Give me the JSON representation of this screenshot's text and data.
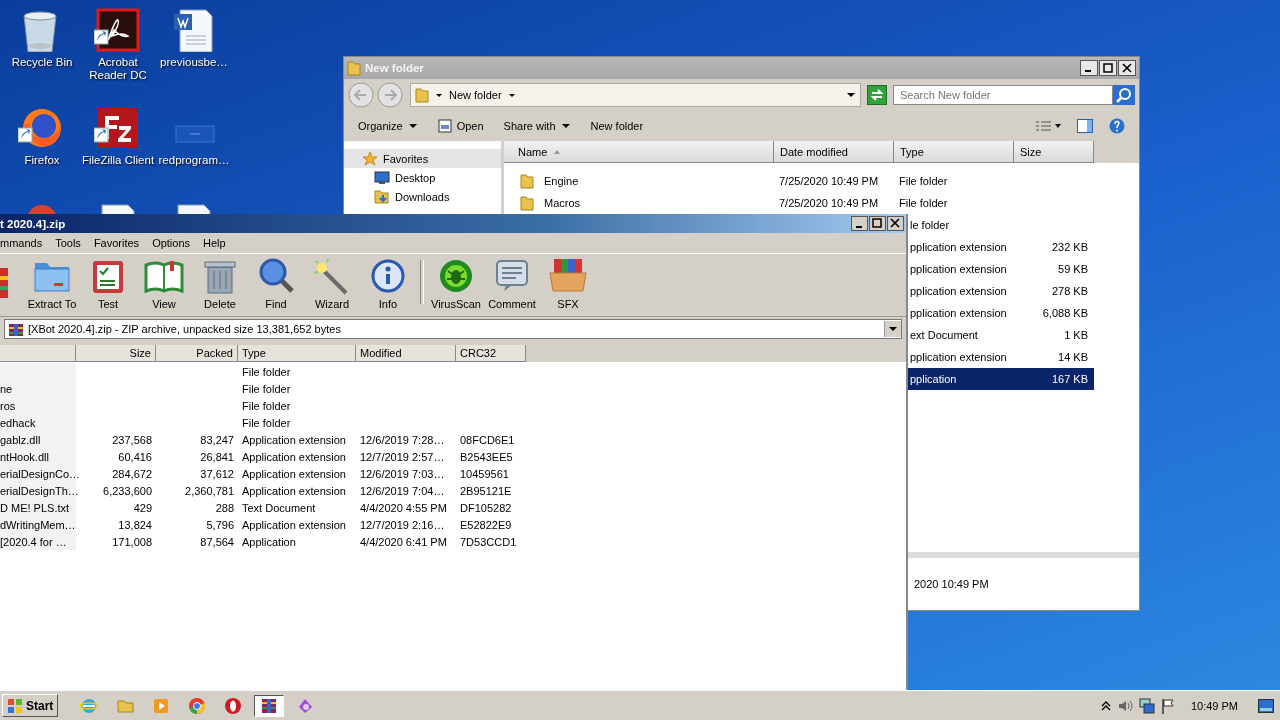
{
  "desktop_icons": [
    {
      "label": "Recycle Bin",
      "kind": "recycle"
    },
    {
      "label": "Acrobat Reader DC",
      "kind": "acrobat"
    },
    {
      "label": "previousbe…",
      "kind": "document"
    },
    {
      "label": "Firefox",
      "kind": "firefox"
    },
    {
      "label": "FileZilla Client",
      "kind": "filezilla"
    },
    {
      "label": "redprogram…",
      "kind": "blank"
    },
    {
      "kind": "redcircle"
    },
    {
      "kind": "page"
    },
    {
      "kind": "page"
    }
  ],
  "explorer": {
    "title": "New folder",
    "address": "New folder",
    "search": {
      "placeholder": "Search New folder"
    },
    "toolbar": [
      {
        "label": "Organize",
        "kind": "menu"
      },
      {
        "label": "Open",
        "kind": "open"
      },
      {
        "label": "Share with",
        "kind": "menu"
      },
      {
        "label": "New folder",
        "kind": "plain"
      }
    ],
    "nav": [
      {
        "label": "Favorites",
        "kind": "favorites",
        "selected": true
      },
      {
        "label": "Desktop",
        "kind": "desktop",
        "selected": false
      },
      {
        "label": "Downloads",
        "kind": "downloads",
        "selected": false
      }
    ],
    "columns": [
      "Name",
      "Date modified",
      "Type",
      "Size"
    ],
    "rows": [
      {
        "name": "Engine",
        "date": "7/25/2020 10:49 PM",
        "type": "File folder",
        "selected": false
      },
      {
        "name": "Macros",
        "date": "7/25/2020 10:49 PM",
        "type": "File folder",
        "selected": false
      },
      {
        "type": "le folder",
        "selected": false
      },
      {
        "type": "pplication extension",
        "size": "232 KB",
        "selected": false
      },
      {
        "type": "pplication extension",
        "size": "59 KB",
        "selected": false
      },
      {
        "type": "pplication extension",
        "size": "278 KB",
        "selected": false
      },
      {
        "type": "pplication extension",
        "size": "6,088 KB",
        "selected": false
      },
      {
        "type": "ext Document",
        "size": "1 KB",
        "selected": false
      },
      {
        "type": "pplication extension",
        "size": "14 KB",
        "selected": false
      },
      {
        "type": "pplication",
        "size": "167 KB",
        "selected": true
      }
    ],
    "details": "2020 10:49 PM"
  },
  "winrar": {
    "title": "t 2020.4].zip",
    "menu": [
      "mmands",
      "Tools",
      "Favorites",
      "Options",
      "Help"
    ],
    "toolbar": [
      {
        "kind": "partial"
      },
      {
        "label": "Extract To",
        "kind": "extract"
      },
      {
        "label": "Test",
        "kind": "test"
      },
      {
        "label": "View",
        "kind": "view"
      },
      {
        "label": "Delete",
        "kind": "delete"
      },
      {
        "label": "Find",
        "kind": "find"
      },
      {
        "label": "Wizard",
        "kind": "wizard"
      },
      {
        "label": "Info",
        "kind": "info"
      },
      {
        "kind": "separator"
      },
      {
        "label": "VirusScan",
        "kind": "virus"
      },
      {
        "label": "Comment",
        "kind": "comment"
      },
      {
        "label": "SFX",
        "kind": "sfx"
      }
    ],
    "path": "[XBot 2020.4].zip - ZIP archive, unpacked size 13,381,652 bytes",
    "columns": [
      "Size",
      "Packed",
      "Type",
      "Modified",
      "CRC32"
    ],
    "rows": [
      {
        "type": "File folder"
      },
      {
        "name": "ne",
        "type": "File folder"
      },
      {
        "name": "ros",
        "type": "File folder"
      },
      {
        "name": "edhack",
        "type": "File folder"
      },
      {
        "name": "gablz.dll",
        "size": "237,568",
        "packed": "83,247",
        "type": "Application extension",
        "modified": "12/6/2019 7:28…",
        "crc": "08FCD6E1"
      },
      {
        "name": "ntHook.dll",
        "size": "60,416",
        "packed": "26,841",
        "type": "Application extension",
        "modified": "12/7/2019 2:57…",
        "crc": "B2543EE5"
      },
      {
        "name": "erialDesignCo…",
        "size": "284,672",
        "packed": "37,612",
        "type": "Application extension",
        "modified": "12/6/2019 7:03…",
        "crc": "10459561"
      },
      {
        "name": "erialDesignTh…",
        "size": "6,233,600",
        "packed": "2,360,781",
        "type": "Application extension",
        "modified": "12/6/2019 7:04…",
        "crc": "2B95121E"
      },
      {
        "name": "D ME! PLS.txt",
        "size": "429",
        "packed": "288",
        "type": "Text Document",
        "modified": "4/4/2020 4:55 PM",
        "crc": "DF105282"
      },
      {
        "name": "dWritingMem…",
        "size": "13,824",
        "packed": "5,796",
        "type": "Application extension",
        "modified": "12/7/2019 2:16…",
        "crc": "E52822E9"
      },
      {
        "name": " [2020.4 for …",
        "size": "171,008",
        "packed": "87,564",
        "type": "Application",
        "modified": "4/4/2020 6:41 PM",
        "crc": "7D53CCD1"
      }
    ]
  },
  "taskbar": {
    "start": "Start",
    "apps": [
      {
        "kind": "ie",
        "selected": false
      },
      {
        "kind": "explorer",
        "selected": false
      },
      {
        "kind": "media",
        "selected": false
      },
      {
        "kind": "chrome",
        "selected": false
      },
      {
        "kind": "opera",
        "selected": false
      },
      {
        "kind": "winrar",
        "selected": true
      },
      {
        "kind": "purple",
        "selected": false
      }
    ],
    "clock": "10:49 PM"
  }
}
